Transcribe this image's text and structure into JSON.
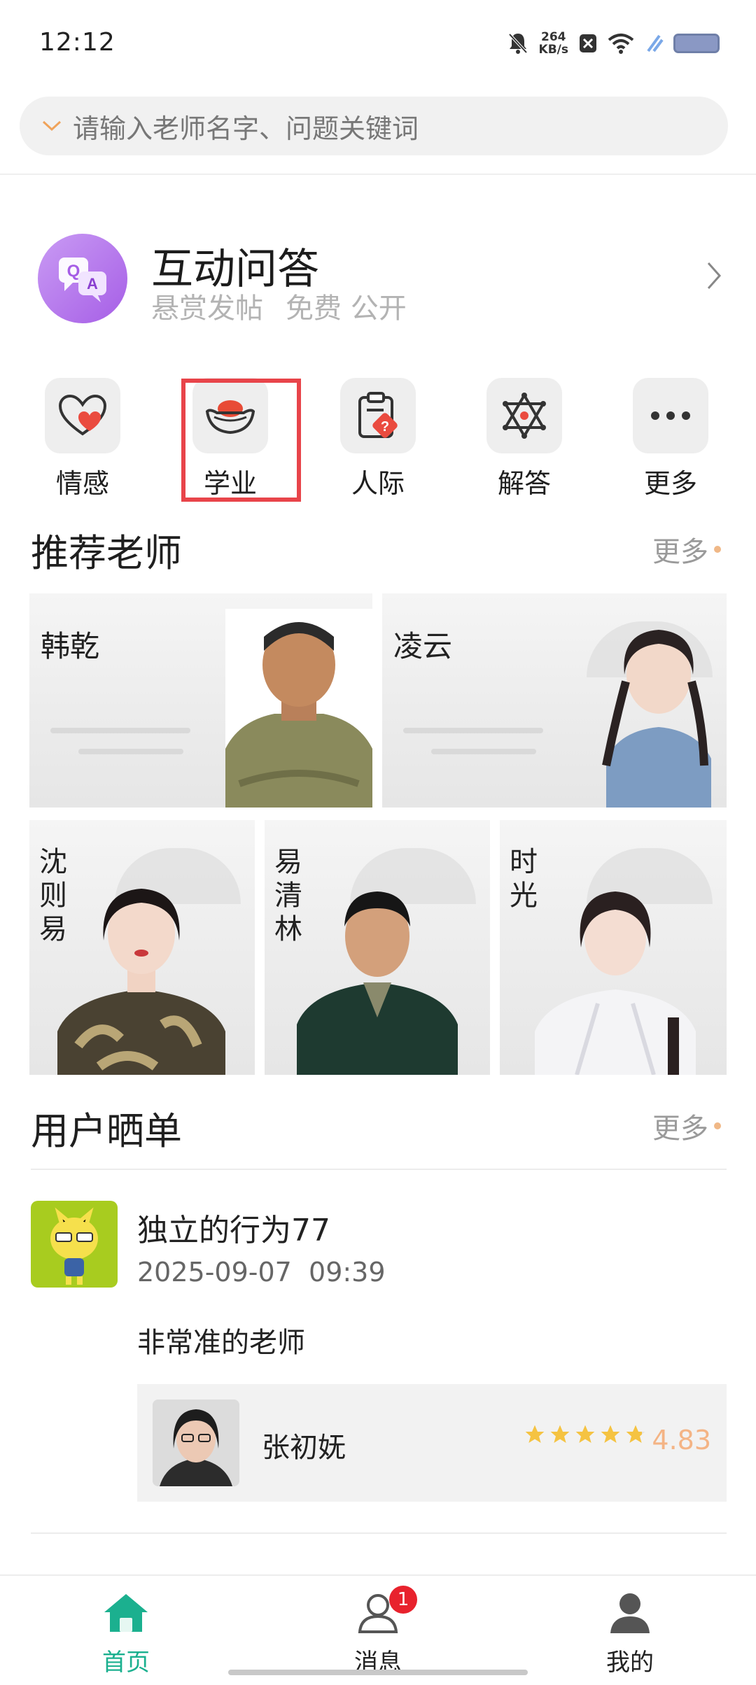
{
  "status_bar": {
    "time": "12:12",
    "speed_value": "264",
    "speed_unit": "KB/s"
  },
  "search": {
    "placeholder": "请输入老师名字、问题关键词"
  },
  "qa": {
    "title": "互动问答",
    "subtitle_parts": [
      "悬赏发帖",
      "免费 公开"
    ]
  },
  "categories": [
    {
      "label": "情感",
      "icon": "heart-icon"
    },
    {
      "label": "学业",
      "icon": "ingot-icon",
      "highlighted": true
    },
    {
      "label": "人际",
      "icon": "clipboard-question-icon"
    },
    {
      "label": "解答",
      "icon": "star-of-david-icon"
    },
    {
      "label": "更多",
      "icon": "more-dots-icon"
    }
  ],
  "recommended": {
    "title": "推荐老师",
    "more": "更多",
    "teachers": [
      {
        "name": "韩乾"
      },
      {
        "name": "凌云"
      },
      {
        "name": "沈则易"
      },
      {
        "name": "易清林"
      },
      {
        "name": "时光"
      }
    ]
  },
  "reviews": {
    "title": "用户晒单",
    "more": "更多",
    "items": [
      {
        "user": "独立的行为77",
        "date": "2025-09-07",
        "time": "09:39",
        "text": "非常准的老师",
        "teacher_name": "张初妩",
        "rating": 4.83,
        "rating_text": "4.83"
      }
    ]
  },
  "bottom_nav": {
    "items": [
      {
        "label": "首页",
        "icon": "home-icon",
        "active": true
      },
      {
        "label": "消息",
        "icon": "message-user-icon",
        "badge": "1"
      },
      {
        "label": "我的",
        "icon": "profile-icon"
      }
    ]
  },
  "colors": {
    "accent": "#1bb08f",
    "highlight_border": "#e8444a",
    "badge": "#e8222d",
    "rating": "#f4b485",
    "star": "#f5c342"
  }
}
